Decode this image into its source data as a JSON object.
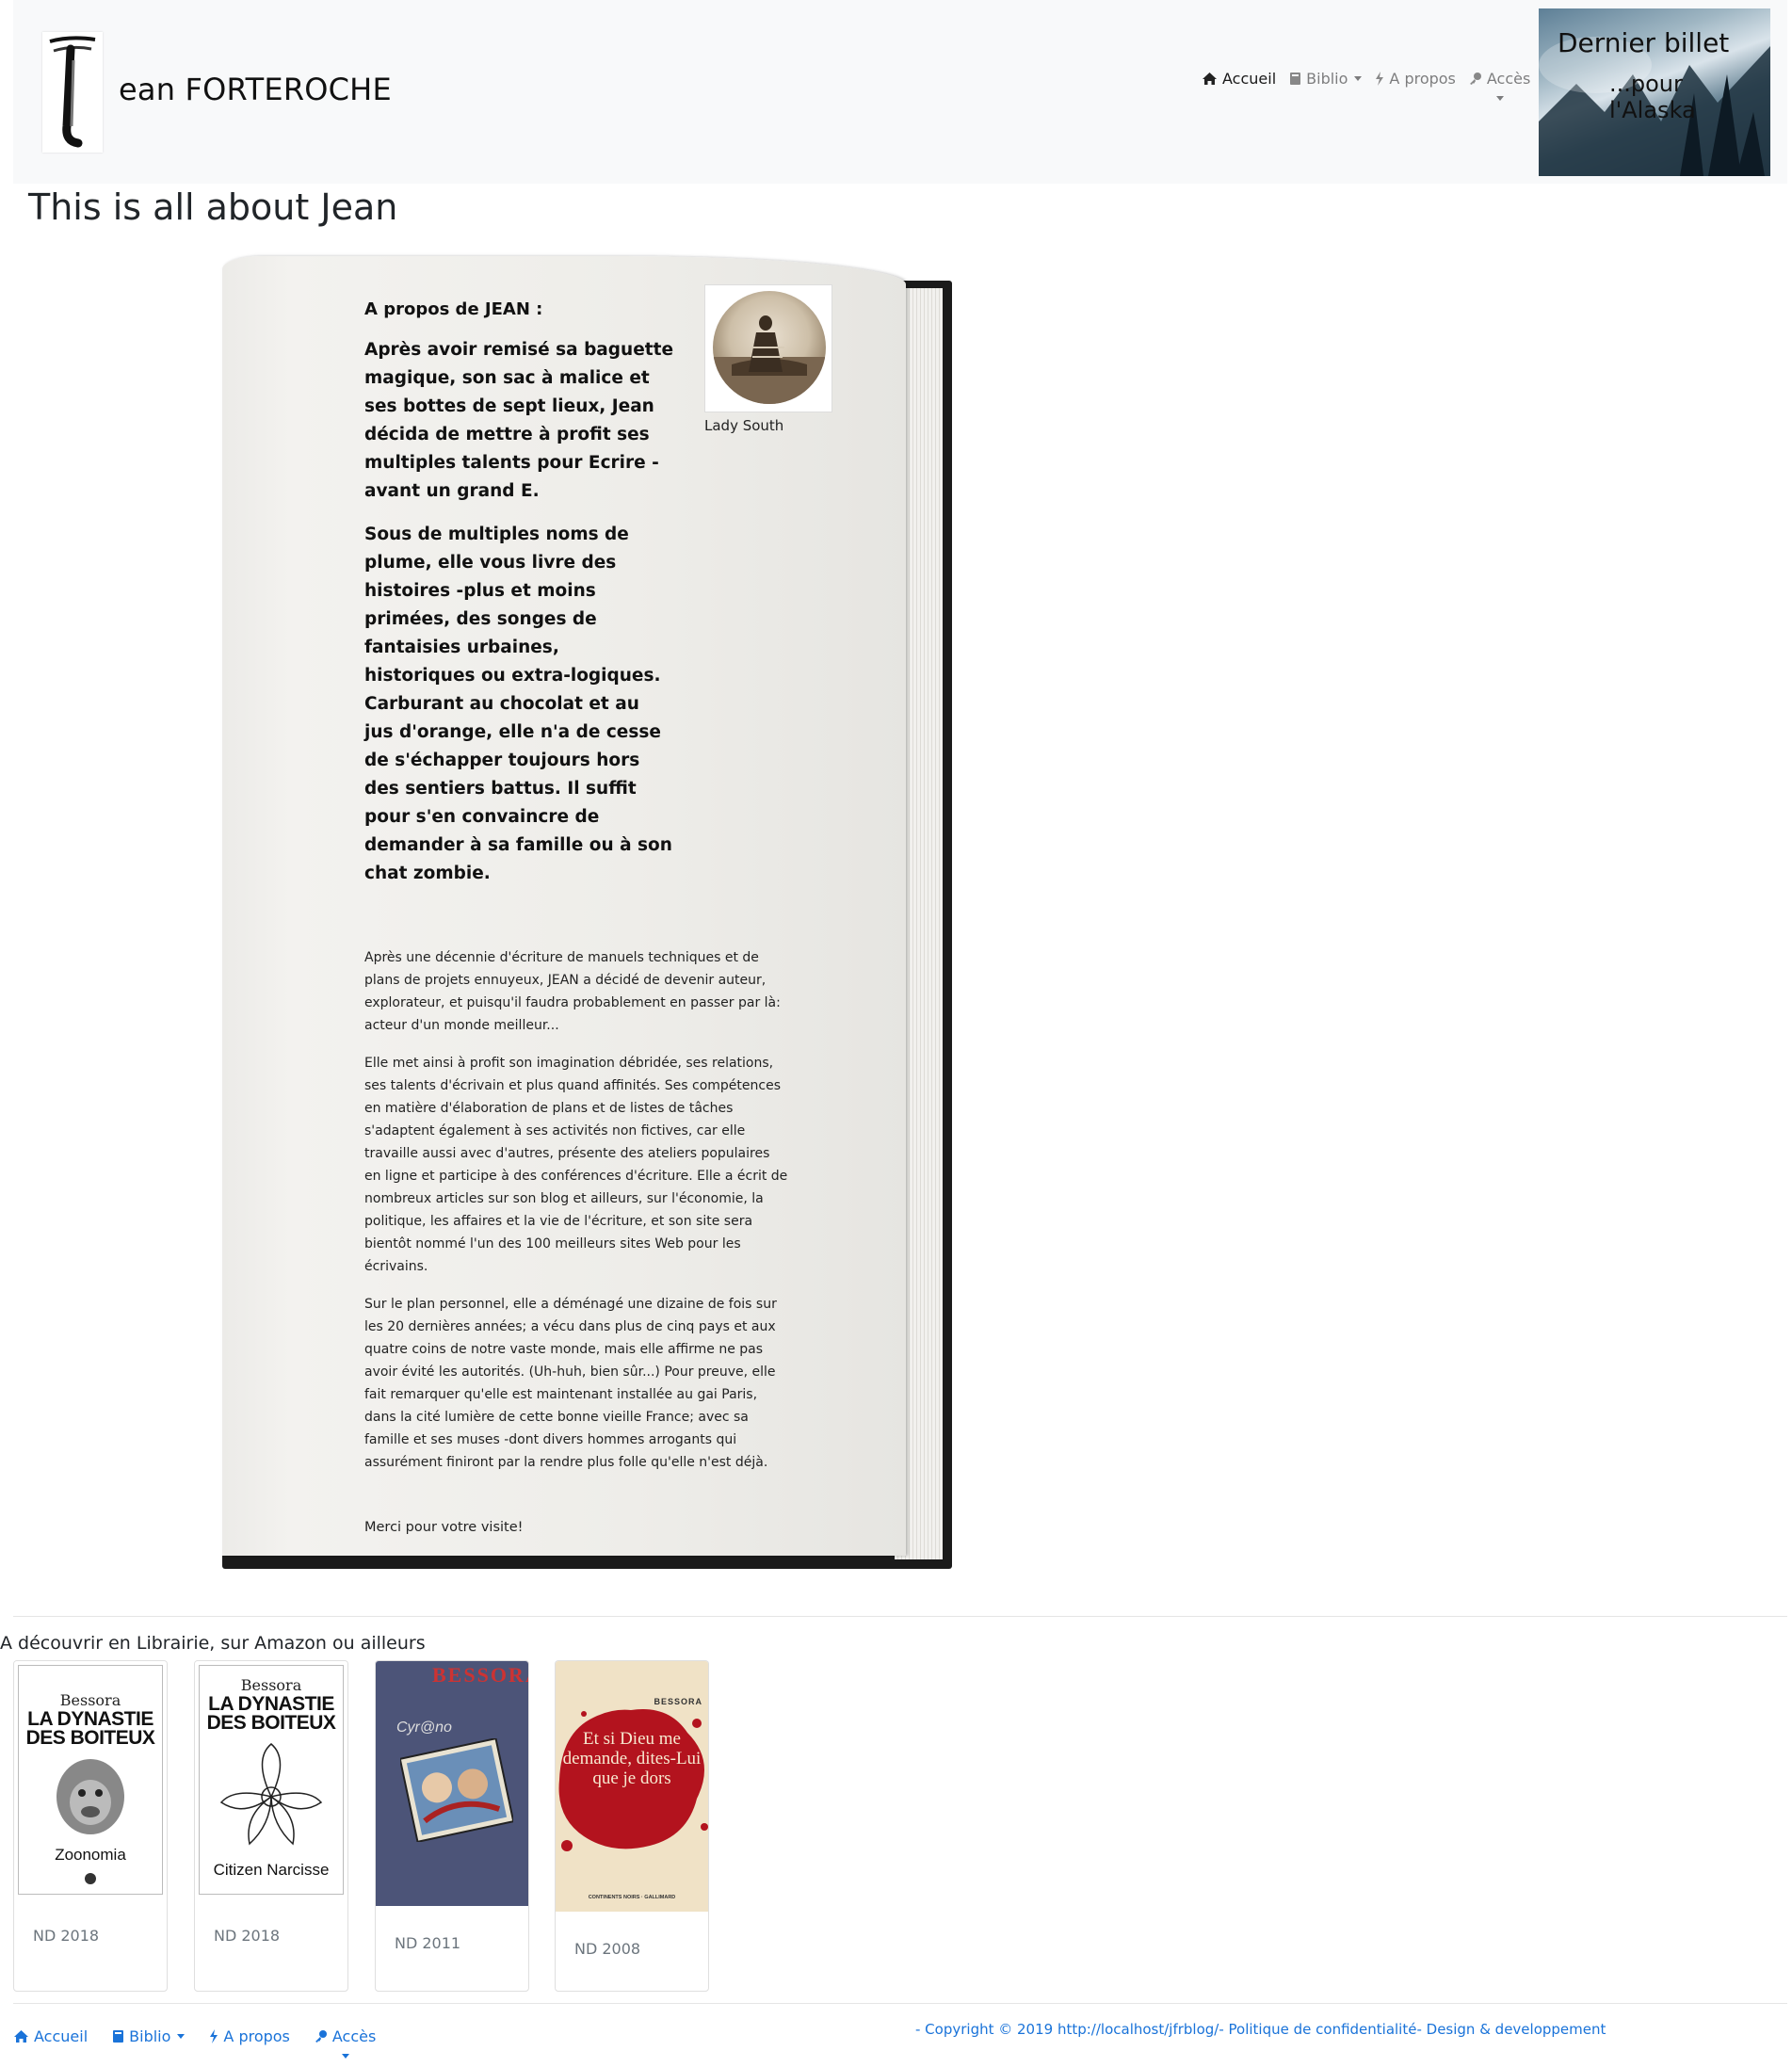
{
  "header": {
    "brand": "ean FORTEROCHE",
    "nav": [
      {
        "label": "Accueil",
        "icon": "home-icon",
        "active": true
      },
      {
        "label": "Biblio",
        "icon": "book-icon",
        "dropdown": true
      },
      {
        "label": "A propos",
        "icon": "bolt-icon"
      },
      {
        "label": "Accès",
        "icon": "key-icon",
        "dropdown": true
      }
    ],
    "last_post": {
      "title": "Dernier billet",
      "subtitle": "...pour l'Alaska"
    }
  },
  "page_title": "This is all about Jean",
  "book": {
    "heading": "A propos de JEAN :",
    "bold_paragraphs": [
      "Après avoir remisé sa baguette magique, son sac à malice et ses bottes de sept lieux, Jean décida de mettre à profit ses multiples talents  pour Ecrire -avant un grand E.",
      "Sous de multiples noms de plume, elle vous livre  des histoires -plus et moins primées, des songes de fantaisies urbaines, historiques ou extra-logiques. Carburant au chocolat et au jus d'orange, elle n'a de cesse de s'échapper toujours hors des sentiers battus. Il suffit pour s'en convaincre de demander à sa famille ou à son chat zombie."
    ],
    "paragraphs": [
      "Après une décennie d'écriture de manuels techniques et de plans de projets ennuyeux, JEAN a décidé de devenir auteur, explorateur, et puisqu'il faudra probablement en passer par là: acteur d'un monde meilleur...",
      "Elle met ainsi à profit son imagination débridée, ses relations, ses talents d'écrivain et plus quand affinités. Ses compétences en matière d'élaboration de plans et de listes de tâches s'adaptent également à ses activités non fictives, car elle travaille aussi avec d'autres, présente des ateliers populaires en ligne et participe à des conférences d'écriture. Elle a écrit de nombreux articles sur son blog et ailleurs, sur l'économie, la politique, les affaires et la vie de l'écriture, et son site sera bientôt nommé l'un des 100 meilleurs sites Web pour les écrivains.",
      "Sur le plan personnel, elle a déménagé une dizaine de fois sur les 20 dernières années; a vécu dans plus de cinq pays  et aux quatre coins de notre vaste monde, mais elle affirme ne pas avoir évité les autorités. (Uh-huh, bien sûr...) Pour preuve, elle fait remarquer qu'elle est maintenant installée au gai Paris, dans la cité lumière de cette bonne vieille France;  avec sa famille et ses muses  -dont divers hommes arrogants qui assurément finiront par la rendre plus folle qu'elle n'est déjà."
    ],
    "photo_caption": "Lady South",
    "thanks": "Merci pour votre visite!"
  },
  "discover": {
    "title": "A découvrir en Librairie, sur Amazon ou ailleurs",
    "books": [
      {
        "author": "Bessora",
        "title_line1": "LA DYNASTIE",
        "title_line2": "DES BOITEUX",
        "subtitle": "Zoonomia",
        "footer": "ND 2018"
      },
      {
        "author": "Bessora",
        "title_line1": "LA DYNASTIE",
        "title_line2": "DES BOITEUX",
        "subtitle": "Citizen Narcisse",
        "footer": "ND 2018"
      },
      {
        "author": "BESSORA",
        "title": "Cyr@no",
        "footer": "ND 2011"
      },
      {
        "author": "BESSORA",
        "title": "Et si Dieu me demande, dites-Lui que je dors",
        "publisher": "CONTINENTS NOIRS · GALLIMARD",
        "footer": "ND 2008"
      }
    ]
  },
  "footer": {
    "nav": [
      {
        "label": "Accueil",
        "icon": "home-icon"
      },
      {
        "label": "Biblio",
        "icon": "book-icon",
        "dropdown": true
      },
      {
        "label": "A propos",
        "icon": "bolt-icon"
      },
      {
        "label": "Accès",
        "icon": "key-icon",
        "dropdown": true
      }
    ],
    "copyright": "- Copyright © 2019 http://localhost/jfrblog/- Politique de confidentialité- Design & developpement"
  },
  "colors": {
    "link": "#1a73d9",
    "header_bg": "#f8f9fa",
    "book_cover": "#1b1b1b"
  }
}
